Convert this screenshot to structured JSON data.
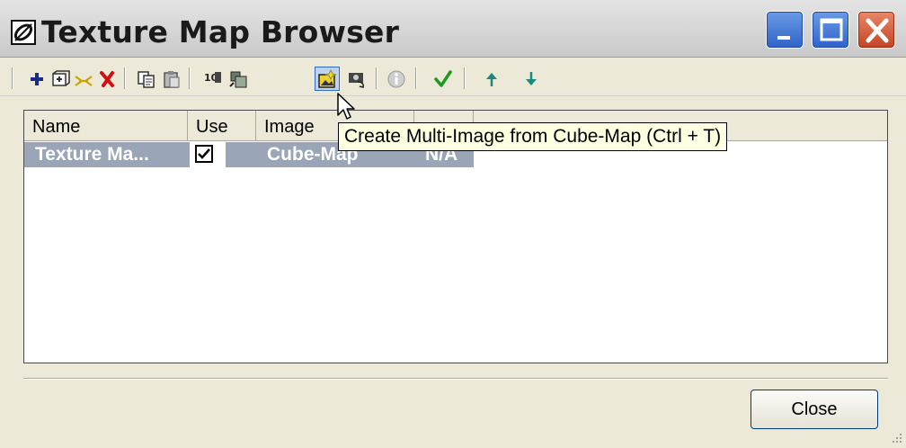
{
  "window": {
    "title": "Texture Map Browser",
    "controls": {
      "minimize": "minimize",
      "maximize": "maximize",
      "close": "close"
    }
  },
  "toolbar": {
    "buttons": [
      {
        "name": "add",
        "icon": "plus-icon",
        "color": "#1a2a8a"
      },
      {
        "name": "import",
        "icon": "import-cube-icon"
      },
      {
        "name": "link",
        "icon": "link-icon",
        "color": "#c8a800"
      },
      {
        "name": "delete",
        "icon": "delete-x-icon",
        "color": "#d01010"
      },
      {
        "name": "copy",
        "icon": "copy-icon"
      },
      {
        "name": "paste",
        "icon": "paste-icon"
      },
      {
        "name": "numbering",
        "icon": "numbering-icon"
      },
      {
        "name": "cube-map",
        "icon": "cube-map-icon"
      },
      {
        "name": "multi-image-from-cube-map",
        "icon": "multi-image-icon",
        "active": true
      },
      {
        "name": "view",
        "icon": "camera-icon"
      },
      {
        "name": "info",
        "icon": "info-icon"
      },
      {
        "name": "apply",
        "icon": "checkmark-icon",
        "color": "#1f9a1f"
      },
      {
        "name": "move-up",
        "icon": "arrow-up-icon",
        "color": "#1c8a7a"
      },
      {
        "name": "move-down",
        "icon": "arrow-down-icon",
        "color": "#1c8a7a"
      }
    ]
  },
  "tooltip": "Create Multi-Image from Cube-Map (Ctrl + T)",
  "list": {
    "columns": [
      "Name",
      "Use",
      "Image",
      ""
    ],
    "rows": [
      {
        "name": "Texture Ma...",
        "use": true,
        "image": "Cube-Map",
        "extra": "N/A"
      }
    ]
  },
  "buttons": {
    "close": "Close"
  },
  "colors": {
    "selection": "#9aa6b8",
    "tooltip_bg": "#ffffe1",
    "face": "#ECE9D8"
  }
}
